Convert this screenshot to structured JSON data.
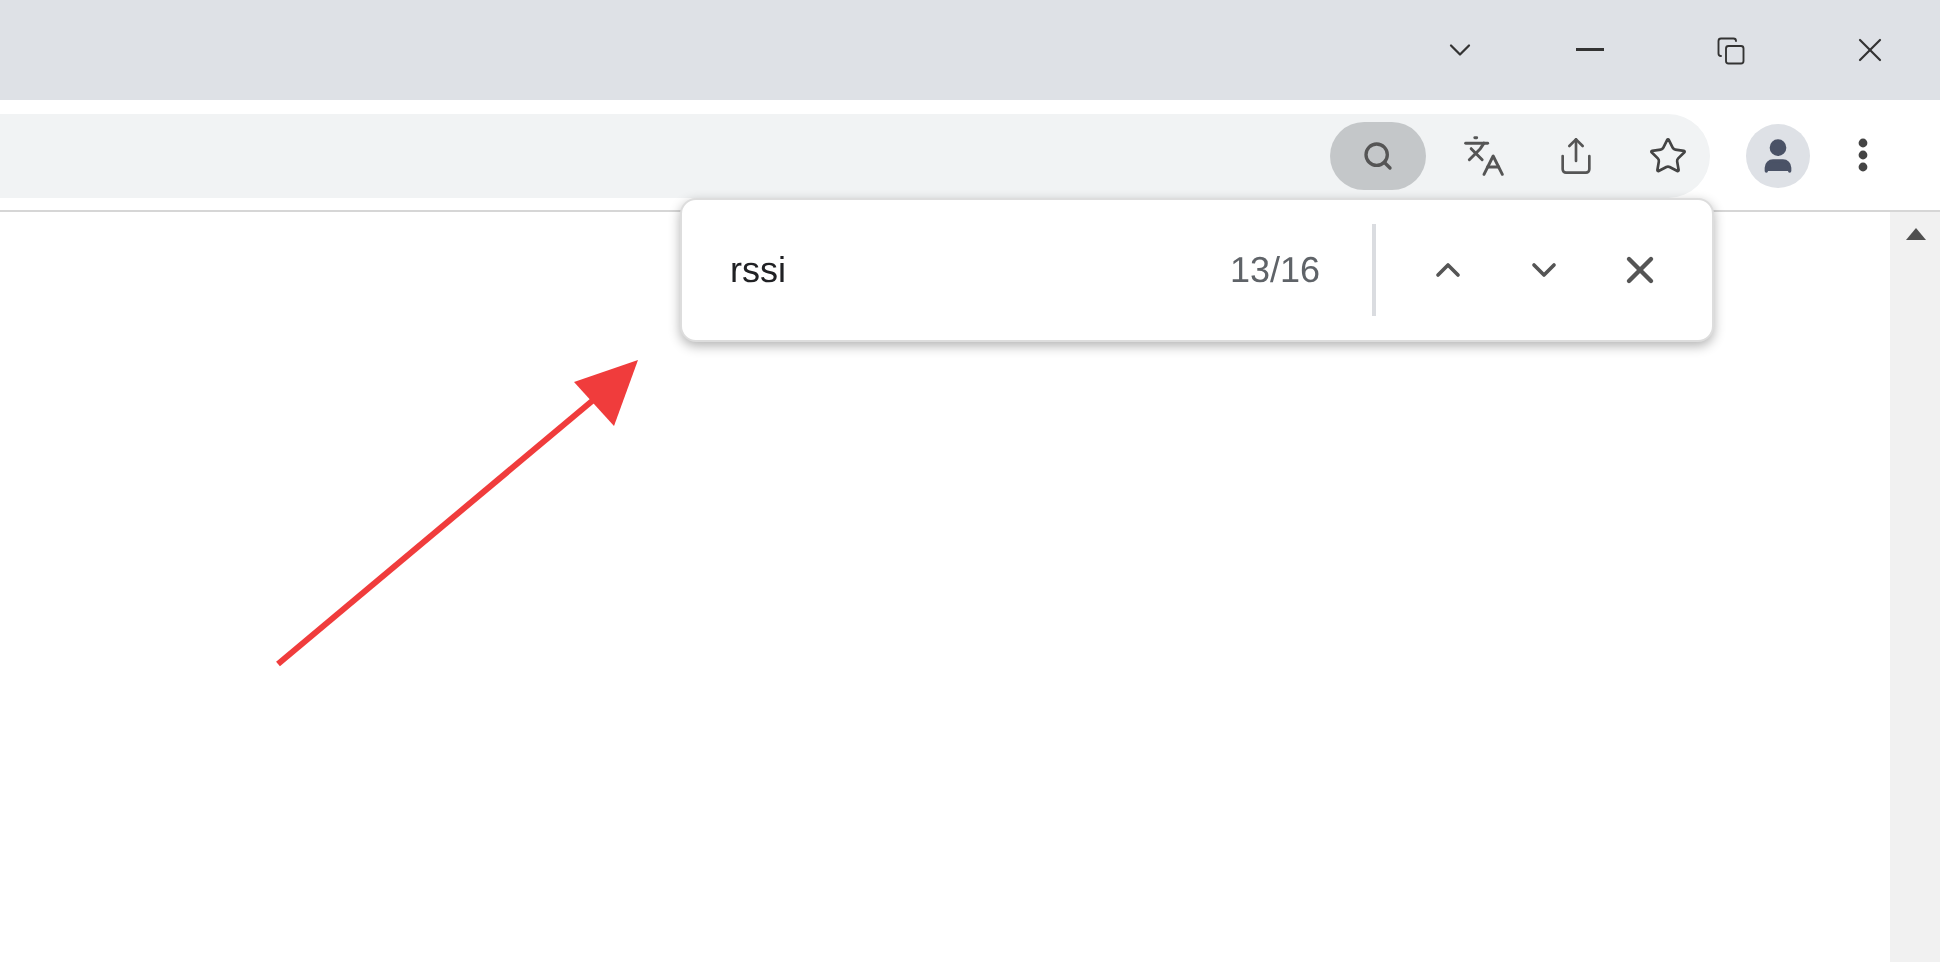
{
  "find_bar": {
    "query": "rssi",
    "match_count": "13/16"
  }
}
